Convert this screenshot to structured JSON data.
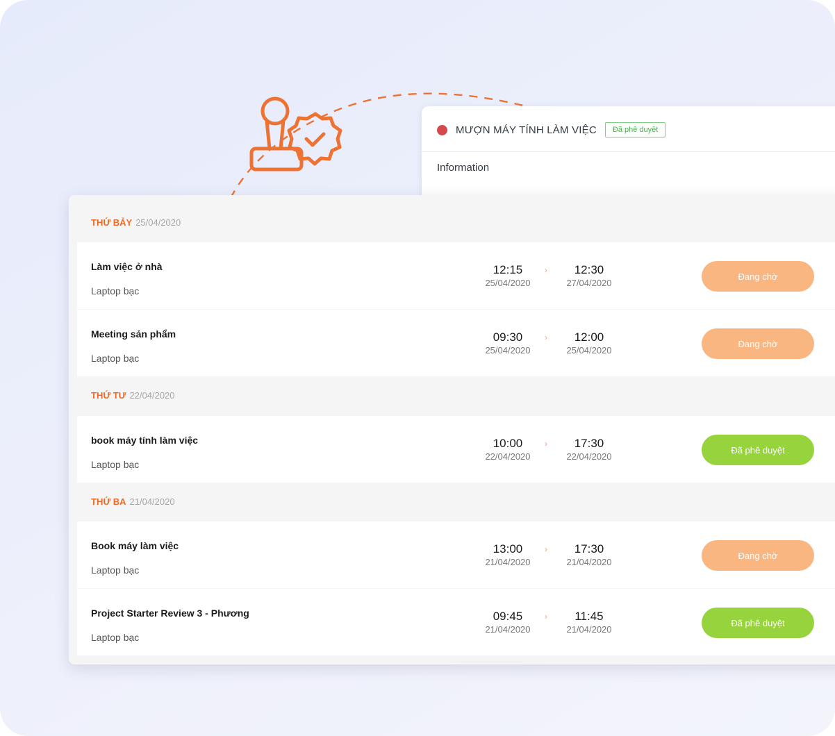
{
  "detail_card": {
    "title": "MƯỢN MÁY TÍNH LÀM VIỆC",
    "status_tag": "Đã phê duyệt",
    "section_label": "Information",
    "colors": {
      "dot": "#d5494c",
      "tag": "#4caf50"
    }
  },
  "illustration": {
    "icon": "stamp-approved-icon",
    "color": "#ec7333"
  },
  "days": [
    {
      "name": "THỨ BẢY",
      "date": "25/04/2020",
      "events": [
        {
          "title": "Làm việc ở nhà",
          "device": "Laptop bạc",
          "start_time": "12:15",
          "start_date": "25/04/2020",
          "end_time": "12:30",
          "end_date": "27/04/2020",
          "status": "Đang chờ"
        },
        {
          "title": "Meeting sản phẩm",
          "device": "Laptop bạc",
          "start_time": "09:30",
          "start_date": "25/04/2020",
          "end_time": "12:00",
          "end_date": "25/04/2020",
          "status": "Đang chờ"
        }
      ]
    },
    {
      "name": "THỨ TƯ",
      "date": "22/04/2020",
      "events": [
        {
          "title": "book máy tính làm việc",
          "device": "Laptop bạc",
          "start_time": "10:00",
          "start_date": "22/04/2020",
          "end_time": "17:30",
          "end_date": "22/04/2020",
          "status": "Đã phê duyệt"
        }
      ]
    },
    {
      "name": "THỨ BA",
      "date": "21/04/2020",
      "events": [
        {
          "title": "Book máy làm việc",
          "device": "Laptop bạc",
          "start_time": "13:00",
          "start_date": "21/04/2020",
          "end_time": "17:30",
          "end_date": "21/04/2020",
          "status": "Đang chờ"
        },
        {
          "title": "Project Starter Review 3 - Phương",
          "device": "Laptop bạc",
          "start_time": "09:45",
          "start_date": "21/04/2020",
          "end_time": "11:45",
          "end_date": "21/04/2020",
          "status": "Đã phê duyệt"
        }
      ]
    }
  ],
  "arrow_glyph": "›",
  "colors": {
    "day_name": "#f06a27",
    "pending": "#f9b681",
    "approved": "#97d33c"
  }
}
